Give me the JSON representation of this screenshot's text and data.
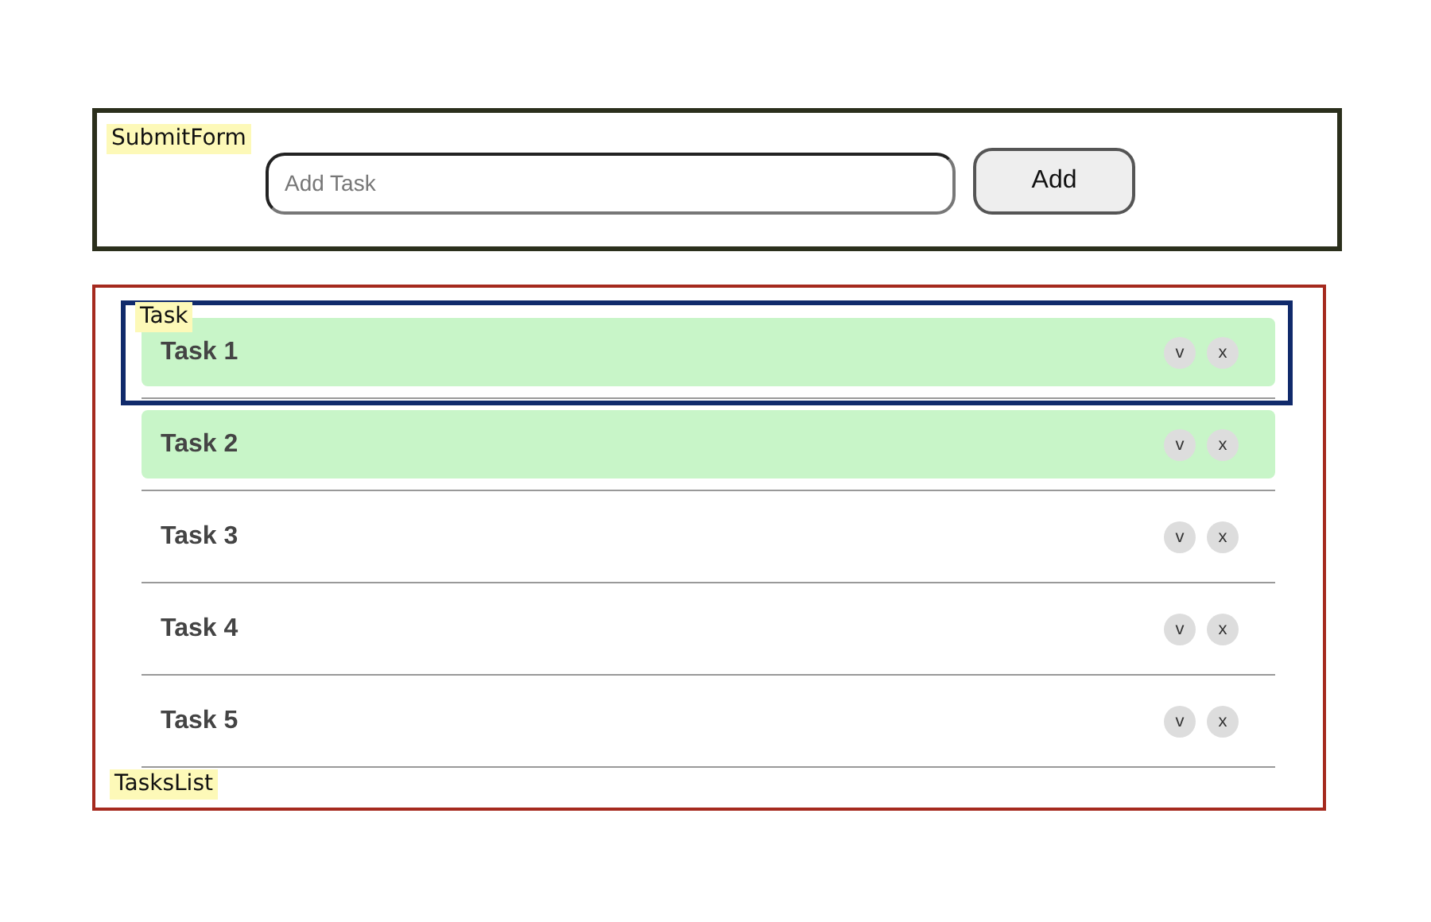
{
  "submit_form": {
    "label": "SubmitForm",
    "placeholder": "Add Task",
    "button": "Add"
  },
  "tasks_list": {
    "label": "TasksList",
    "task_label": "Task",
    "tasks": [
      {
        "name": "Task 1",
        "done": true,
        "buttons": [
          "v",
          "x"
        ]
      },
      {
        "name": "Task 2",
        "done": true,
        "buttons": [
          "v",
          "x"
        ]
      },
      {
        "name": "Task 3",
        "done": false,
        "buttons": [
          "v",
          "x"
        ]
      },
      {
        "name": "Task 4",
        "done": false,
        "buttons": [
          "v",
          "x"
        ]
      },
      {
        "name": "Task 5",
        "done": false,
        "buttons": [
          "v",
          "x"
        ]
      }
    ]
  }
}
